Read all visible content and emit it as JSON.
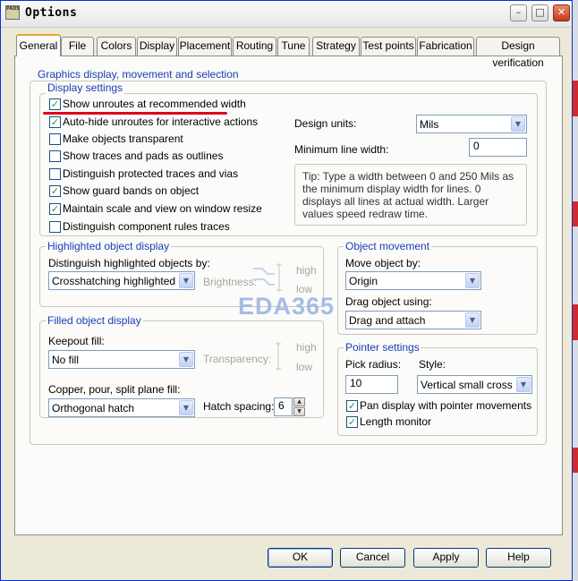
{
  "window": {
    "title": "Options",
    "icon_text": "PADS"
  },
  "tabs": [
    {
      "label": "General"
    },
    {
      "label": "File"
    },
    {
      "label": "Colors"
    },
    {
      "label": "Display"
    },
    {
      "label": "Placement"
    },
    {
      "label": "Routing"
    },
    {
      "label": "Tune"
    },
    {
      "label": "Strategy"
    },
    {
      "label": "Test points"
    },
    {
      "label": "Fabrication"
    },
    {
      "label": "Design verification"
    }
  ],
  "groups": {
    "graphics": "Graphics display, movement and selection",
    "display_settings": "Display settings",
    "highlighted": "Highlighted object display",
    "filled": "Filled object display",
    "movement": "Object movement",
    "pointer": "Pointer settings"
  },
  "display_settings": {
    "checkboxes": [
      {
        "label": "Show unroutes at recommended width",
        "checked": true
      },
      {
        "label": "Auto-hide unroutes for interactive actions",
        "checked": true
      },
      {
        "label": "Make objects transparent",
        "checked": false
      },
      {
        "label": "Show traces and pads as outlines",
        "checked": false
      },
      {
        "label": "Distinguish protected traces and vias",
        "checked": false
      },
      {
        "label": "Show guard bands on object",
        "checked": true
      },
      {
        "label": "Maintain scale and view on window resize",
        "checked": true
      },
      {
        "label": "Distinguish component rules traces",
        "checked": false
      }
    ],
    "design_units_label": "Design units:",
    "design_units_value": "Mils",
    "min_line_width_label": "Minimum line width:",
    "min_line_width_value": "0",
    "tip": "Tip: Type a width between 0 and 250 Mils as the minimum display width for lines. 0 displays all lines at actual width. Larger values speed redraw time."
  },
  "highlighted": {
    "distinguish_label": "Distinguish highlighted objects by:",
    "distinguish_value": "Crosshatching highlighted obje",
    "brightness_label": "Brightness:",
    "high": "high",
    "low": "low"
  },
  "filled": {
    "keepout_label": "Keepout fill:",
    "keepout_value": "No fill",
    "transparency_label": "Transparency:",
    "high": "high",
    "low": "low",
    "copper_label": "Copper, pour, split plane fill:",
    "copper_value": "Orthogonal hatch",
    "hatch_label": "Hatch spacing:",
    "hatch_value": "6"
  },
  "movement": {
    "move_label": "Move object by:",
    "move_value": "Origin",
    "drag_label": "Drag object using:",
    "drag_value": "Drag and attach"
  },
  "pointer": {
    "pick_label": "Pick radius:",
    "pick_value": "10",
    "style_label": "Style:",
    "style_value": "Vertical small cross",
    "pan_label": "Pan display with pointer movements",
    "pan_checked": true,
    "length_label": "Length monitor",
    "length_checked": true
  },
  "watermark": "EDA365",
  "buttons": {
    "ok": "OK",
    "cancel": "Cancel",
    "apply": "Apply",
    "help": "Help"
  },
  "colors": {
    "accent_red": "#e1001a",
    "group_title": "#1a3db5",
    "tab_highlight": "#e9a535"
  }
}
